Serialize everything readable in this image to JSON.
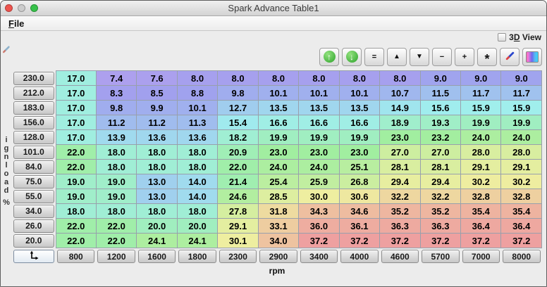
{
  "window": {
    "title": "Spark Advance Table1"
  },
  "menu": {
    "file": {
      "mnemonic": "F",
      "rest": "ile"
    }
  },
  "view_toggle": {
    "pre": "3",
    "mnemonic": "D",
    "post": " View",
    "checked": false
  },
  "toolbar": {
    "buttons": [
      {
        "name": "scale-up-button",
        "icon": "circle-arrow-up-icon",
        "type": "circle",
        "glyph": "↑"
      },
      {
        "name": "scale-down-button",
        "icon": "circle-arrow-down-icon",
        "type": "circle",
        "glyph": "↓"
      },
      {
        "name": "set-equal-button",
        "icon": "equals-icon",
        "type": "text",
        "glyph": "="
      },
      {
        "name": "increase-button",
        "icon": "triangle-up-icon",
        "type": "text",
        "glyph": "▲"
      },
      {
        "name": "decrease-button",
        "icon": "triangle-down-icon",
        "type": "text",
        "glyph": "▼"
      },
      {
        "name": "subtract-button",
        "icon": "minus-icon",
        "type": "text",
        "glyph": "−"
      },
      {
        "name": "add-button",
        "icon": "plus-icon",
        "type": "text",
        "glyph": "+"
      },
      {
        "name": "multiply-button",
        "icon": "asterisk-icon",
        "type": "text",
        "glyph": "*"
      },
      {
        "name": "edit-pencil-button",
        "icon": "pencil-icon",
        "type": "pencil"
      },
      {
        "name": "colormap-button",
        "icon": "gradient-icon",
        "type": "gradient"
      }
    ]
  },
  "table": {
    "y_axis_label": "ignload %",
    "x_axis_label": "rpm",
    "corner_icon": "axis-arrows-icon",
    "col_headers": [
      "800",
      "1200",
      "1600",
      "1800",
      "2300",
      "2900",
      "3400",
      "4000",
      "4600",
      "5700",
      "7000",
      "8000"
    ],
    "row_headers": [
      "230.0",
      "212.0",
      "183.0",
      "156.0",
      "128.0",
      "101.0",
      "84.0",
      "75.0",
      "55.0",
      "34.0",
      "26.0",
      "20.0"
    ],
    "rows": [
      [
        "17.0",
        "7.4",
        "7.6",
        "8.0",
        "8.0",
        "8.0",
        "8.0",
        "8.0",
        "8.0",
        "9.0",
        "9.0",
        "9.0"
      ],
      [
        "17.0",
        "8.3",
        "8.5",
        "8.8",
        "9.8",
        "10.1",
        "10.1",
        "10.1",
        "10.7",
        "11.5",
        "11.7",
        "11.7"
      ],
      [
        "17.0",
        "9.8",
        "9.9",
        "10.1",
        "12.7",
        "13.5",
        "13.5",
        "13.5",
        "14.9",
        "15.6",
        "15.9",
        "15.9"
      ],
      [
        "17.0",
        "11.2",
        "11.2",
        "11.3",
        "15.4",
        "16.6",
        "16.6",
        "16.6",
        "18.9",
        "19.3",
        "19.9",
        "19.9"
      ],
      [
        "17.0",
        "13.9",
        "13.6",
        "13.6",
        "18.2",
        "19.9",
        "19.9",
        "19.9",
        "23.0",
        "23.2",
        "24.0",
        "24.0"
      ],
      [
        "22.0",
        "18.0",
        "18.0",
        "18.0",
        "20.9",
        "23.0",
        "23.0",
        "23.0",
        "27.0",
        "27.0",
        "28.0",
        "28.0"
      ],
      [
        "22.0",
        "18.0",
        "18.0",
        "18.0",
        "22.0",
        "24.0",
        "24.0",
        "25.1",
        "28.1",
        "28.1",
        "29.1",
        "29.1"
      ],
      [
        "19.0",
        "19.0",
        "13.0",
        "14.0",
        "21.4",
        "25.4",
        "25.9",
        "26.8",
        "29.4",
        "29.4",
        "30.2",
        "30.2"
      ],
      [
        "19.0",
        "19.0",
        "13.0",
        "14.0",
        "24.6",
        "28.5",
        "30.0",
        "30.6",
        "32.2",
        "32.2",
        "32.8",
        "32.8"
      ],
      [
        "18.0",
        "18.0",
        "18.0",
        "18.0",
        "27.8",
        "31.8",
        "34.3",
        "34.6",
        "35.2",
        "35.2",
        "35.4",
        "35.4"
      ],
      [
        "22.0",
        "22.0",
        "20.0",
        "20.0",
        "29.1",
        "33.1",
        "36.0",
        "36.1",
        "36.3",
        "36.3",
        "36.4",
        "36.4"
      ],
      [
        "22.0",
        "22.0",
        "24.1",
        "24.1",
        "30.1",
        "34.0",
        "37.2",
        "37.2",
        "37.2",
        "37.2",
        "37.2",
        "37.2"
      ]
    ]
  },
  "colors": {
    "colormap_low_hue": 250,
    "colormap_high_hue": 0,
    "colormap_saturation": 70,
    "colormap_lightness": 78,
    "traffic_red": "#ee544e",
    "traffic_middle": "#cccccc",
    "traffic_green": "#37c24a"
  }
}
